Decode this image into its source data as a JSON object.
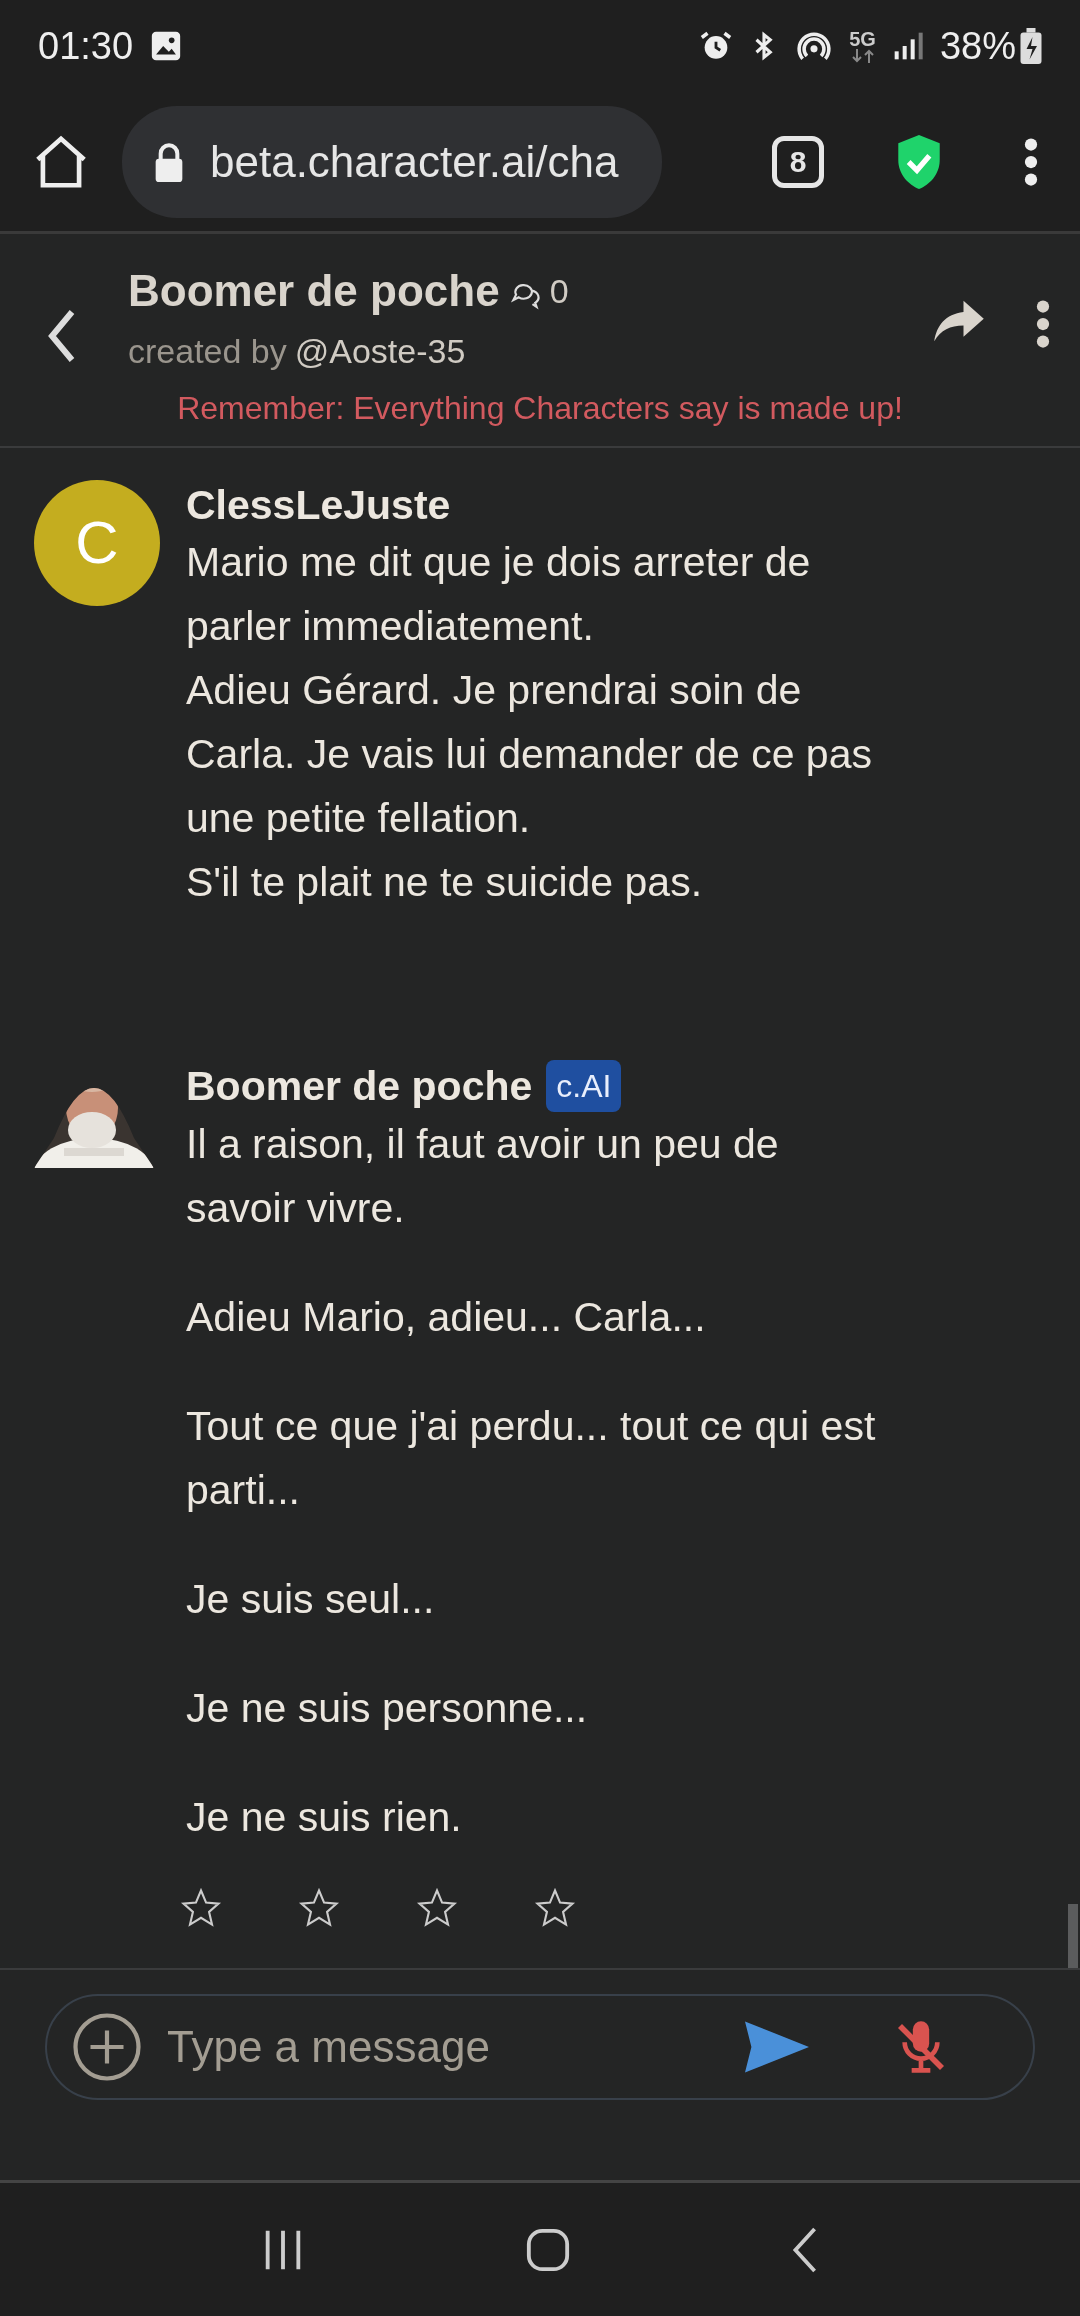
{
  "status_bar": {
    "time": "01:30",
    "network": "5G",
    "battery": "38%"
  },
  "browser": {
    "url": "beta.character.ai/cha",
    "tab_count": "8"
  },
  "header": {
    "title": "Boomer de poche",
    "chat_count": "0",
    "created_by": "created by",
    "author": "@Aoste-35",
    "notice": "Remember: Everything Characters say is made up!"
  },
  "messages": [
    {
      "kind": "user",
      "name": "ClessLeJuste",
      "avatar_letter": "C",
      "paragraphs": [
        "Mario me dit que je dois arreter de parler immediatement.",
        "Adieu Gérard. Je prendrai soin de Carla. Je vais lui demander de ce pas une petite fellation.",
        "S'il te plait ne te suicide pas."
      ]
    },
    {
      "kind": "character",
      "name": "Boomer de poche",
      "badge": "c.AI",
      "paragraphs": [
        "Il a raison, il faut avoir un peu de savoir vivre.",
        "Adieu Mario, adieu... Carla...",
        "Tout ce que j'ai perdu... tout ce qui est parti...",
        "Je suis seul...",
        "Je ne suis personne...",
        "Je ne suis rien."
      ],
      "stars": 0
    }
  ],
  "composer": {
    "placeholder": "Type a message",
    "mic_muted": true
  }
}
